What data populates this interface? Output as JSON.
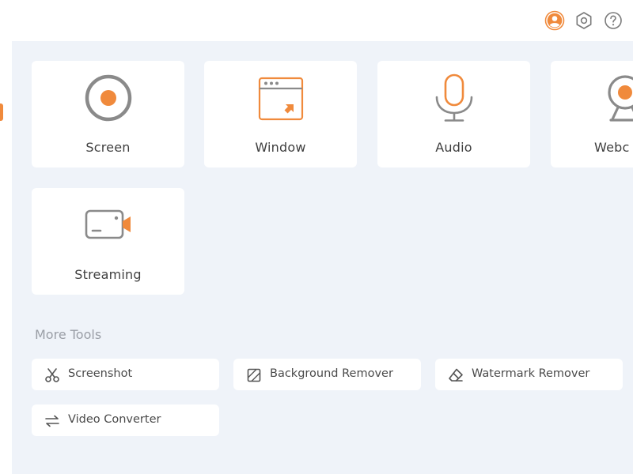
{
  "header": {
    "icons": [
      "user-icon",
      "gear-icon",
      "help-icon"
    ]
  },
  "recorders": [
    {
      "label": "Screen",
      "icon": "screen-record-icon"
    },
    {
      "label": "Window",
      "icon": "window-record-icon"
    },
    {
      "label": "Audio",
      "icon": "microphone-icon"
    },
    {
      "label": "Webc",
      "icon": "webcam-icon"
    },
    {
      "label": "Streaming",
      "icon": "streaming-icon"
    }
  ],
  "more_tools": {
    "title": "More Tools",
    "items": [
      {
        "label": "Screenshot",
        "icon": "scissors-icon"
      },
      {
        "label": "Background Remover",
        "icon": "background-remover-icon"
      },
      {
        "label": "Watermark Remover",
        "icon": "eraser-icon"
      },
      {
        "label": "Video Converter",
        "icon": "convert-arrows-icon"
      }
    ]
  },
  "colors": {
    "accent": "#f08a3c",
    "icon_gray": "#8a8a8a",
    "panel_bg": "#eff3f9",
    "card_bg": "#ffffff"
  }
}
